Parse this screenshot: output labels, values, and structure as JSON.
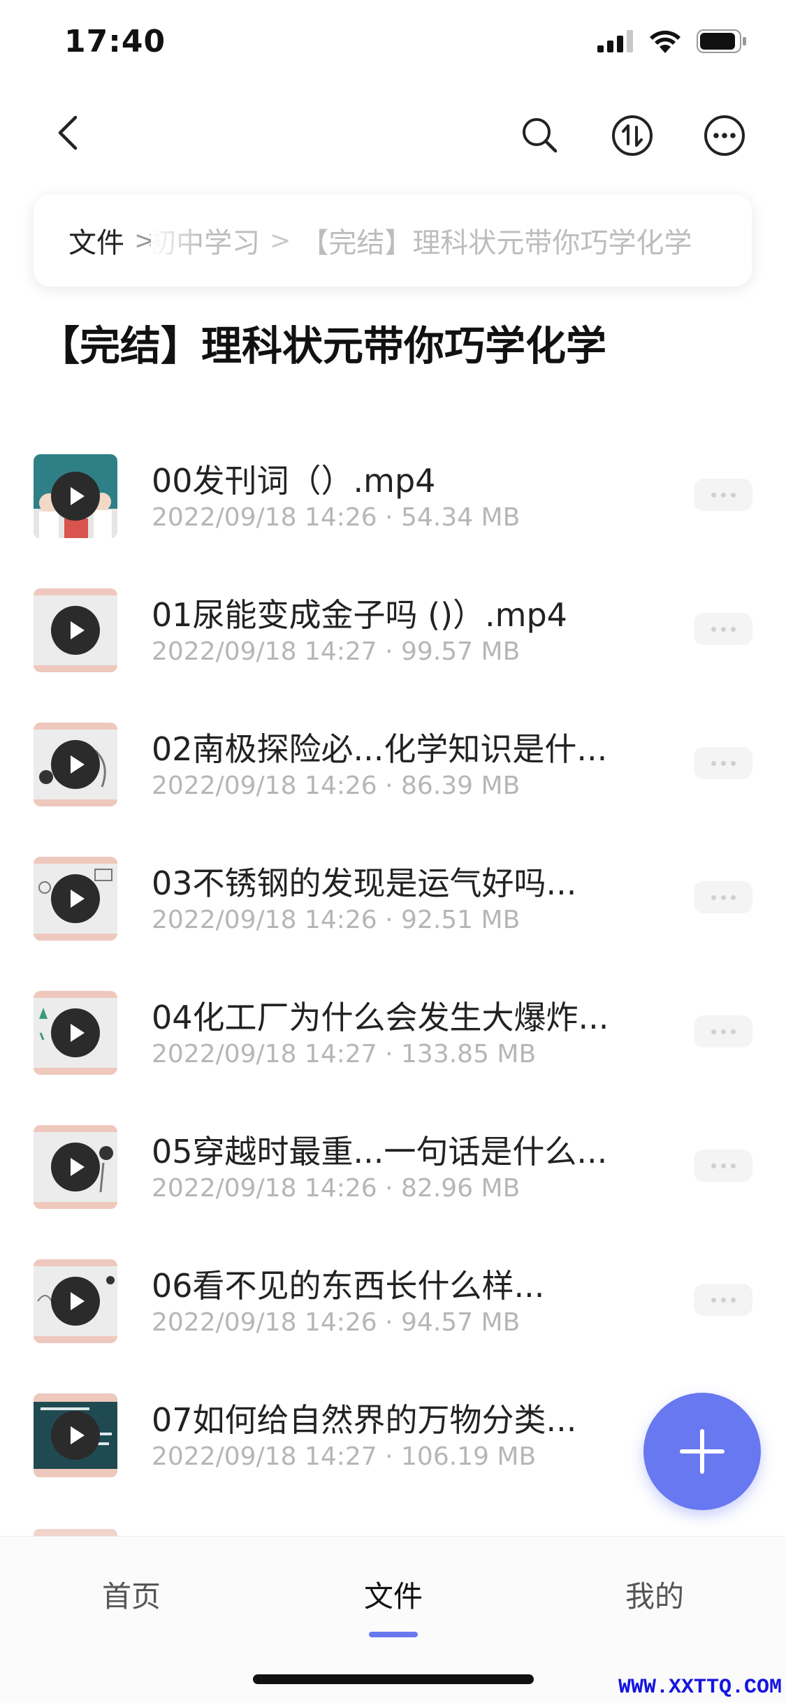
{
  "status_bar": {
    "time": "17:40"
  },
  "nav": {
    "icons": [
      "back-icon",
      "search-icon",
      "sort-icon",
      "more-icon"
    ]
  },
  "breadcrumb": {
    "root": "文件",
    "middle": "初中学习",
    "current": "【完结】理科状元带你巧学化学"
  },
  "page_title": "【完结】理科状元带你巧学化学",
  "files": [
    {
      "name": "00发刊词（）.mp4",
      "meta": "2022/09/18 14:26 · 54.34 MB"
    },
    {
      "name": "01尿能变成金子吗 ()）.mp4",
      "meta": "2022/09/18 14:27 · 99.57 MB"
    },
    {
      "name": "02南极探险必...化学知识是什...",
      "meta": "2022/09/18 14:26 · 86.39 MB"
    },
    {
      "name": "03不锈钢的发现是运气好吗...",
      "meta": "2022/09/18 14:26 · 92.51 MB"
    },
    {
      "name": "04化工厂为什么会发生大爆炸...",
      "meta": "2022/09/18 14:27 · 133.85 MB"
    },
    {
      "name": "05穿越时最重...一句话是什么...",
      "meta": "2022/09/18 14:26 · 82.96 MB"
    },
    {
      "name": "06看不见的东西长什么样...",
      "meta": "2022/09/18 14:26 · 94.57 MB"
    },
    {
      "name": "07如何给自然界的万物分类...",
      "meta": "2022/09/18 14:27 · 106.19 MB"
    }
  ],
  "tabs": [
    {
      "label": "首页"
    },
    {
      "label": "文件"
    },
    {
      "label": "我的"
    }
  ],
  "active_tab": "文件",
  "colors": {
    "accent": "#6878f0",
    "meta_text": "#b6b6b6"
  },
  "watermark": "WWW.XXTTQ.COM"
}
